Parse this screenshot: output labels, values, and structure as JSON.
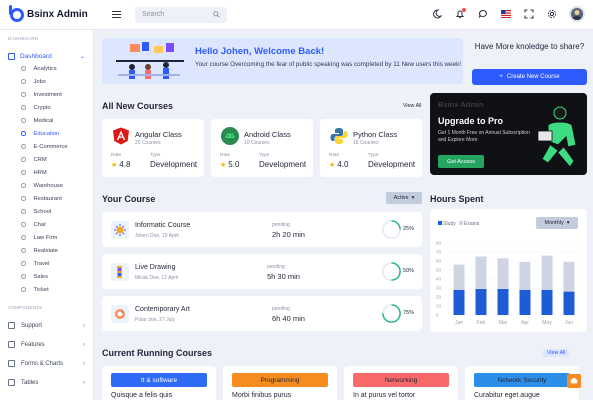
{
  "app": {
    "brand": "Bsinx Admin",
    "search_placeholder": "Search"
  },
  "sidebar": {
    "section_dashboard": "DASHBOARD",
    "dashboard": "Dashboard",
    "items": [
      "Analytics",
      "Jobs",
      "Investment",
      "Crypto",
      "Medical",
      "Education",
      "E-Commerce",
      "CRM",
      "HRM",
      "Warehouse",
      "Restaurant",
      "School",
      "Chat",
      "Law Firm",
      "Realstate",
      "Travel",
      "Sales",
      "Ticket"
    ],
    "active_item": "Education",
    "section_components": "COMPONENTS",
    "groups": [
      "Support",
      "Features",
      "Forms & Charts",
      "Tables"
    ]
  },
  "welcome": {
    "title": "Hello Johen, Welcome Back!",
    "text": "Your course Overcoming the fear of public speaking was completed by 11 New users this week!"
  },
  "share": {
    "text": "Have More knoledge to share?",
    "button": "Create New Course"
  },
  "new_courses": {
    "title": "All New Courses",
    "view_all": "View All",
    "rate_label": "Rate",
    "type_label": "Type",
    "items": [
      {
        "name": "Angular Class",
        "count": "20 Courses",
        "rate": "4.8",
        "type": "Development",
        "icon": "angular-icon",
        "color": "#dd1b16"
      },
      {
        "name": "Android Class",
        "count": "10 Courses",
        "rate": "5.0",
        "type": "Development",
        "icon": "android-icon",
        "color": "#3ddc84"
      },
      {
        "name": "Python Class",
        "count": "18 Courses",
        "rate": "4.0",
        "type": "Development",
        "icon": "python-icon",
        "color": "#3776ab"
      }
    ]
  },
  "promo": {
    "brand": "Bsinx Admin",
    "title": "Upgrade to Pro",
    "text": "Get 1 Month Free on Annual Subscription and Explore More",
    "button": "Get Access"
  },
  "your_course": {
    "title": "Your Course",
    "filter": "Active",
    "pending_label": "pending",
    "items": [
      {
        "name": "Informatic Course",
        "meta": "Johen Doe, 19 April",
        "time": "2h 20 min",
        "progress": 25,
        "progress_label": "25%"
      },
      {
        "name": "Live Drawing",
        "meta": "Micak Doe, 12 April",
        "time": "5h 30 min",
        "progress": 50,
        "progress_label": "50%"
      },
      {
        "name": "Contemporary Art",
        "meta": "Polar doe, 27 July",
        "time": "6h 40 min",
        "progress": 75,
        "progress_label": "75%"
      }
    ]
  },
  "hours": {
    "title": "Hours Spent",
    "filter": "Monthly"
  },
  "chart_data": {
    "type": "bar",
    "categories": [
      "Jan",
      "Feb",
      "Mar",
      "Apr",
      "May",
      "Jun"
    ],
    "series": [
      {
        "name": "Study",
        "values": [
          28,
          29,
          29,
          28,
          28,
          26
        ],
        "color": "#1e5bd6"
      },
      {
        "name": "Exams",
        "values": [
          28,
          36,
          34,
          31,
          38,
          33
        ],
        "color": "#cfd4e2"
      }
    ],
    "ylim": [
      0,
      80
    ],
    "yticks": [
      "80",
      "70",
      "60",
      "50",
      "40",
      "30",
      "20",
      "10",
      "0"
    ],
    "stacked": true,
    "legend": "top-left",
    "grid": true
  },
  "running": {
    "title": "Current Running Courses",
    "view_all": "View All",
    "items": [
      {
        "badge": "It & software",
        "name": "Quisque a felis quis",
        "bg": "#2e6cf6",
        "fg": "#ffffff"
      },
      {
        "badge": "Programming",
        "name": "Morbi finibus purus",
        "bg": "#f68b1f",
        "fg": "#1f2537"
      },
      {
        "badge": "Networking",
        "name": "In at purus vel tortor",
        "bg": "#f9696a",
        "fg": "#1f2537"
      },
      {
        "badge": "Network Security",
        "name": "Curabitur eget augue",
        "bg": "#2b8fea",
        "fg": "#1f2537"
      }
    ]
  }
}
